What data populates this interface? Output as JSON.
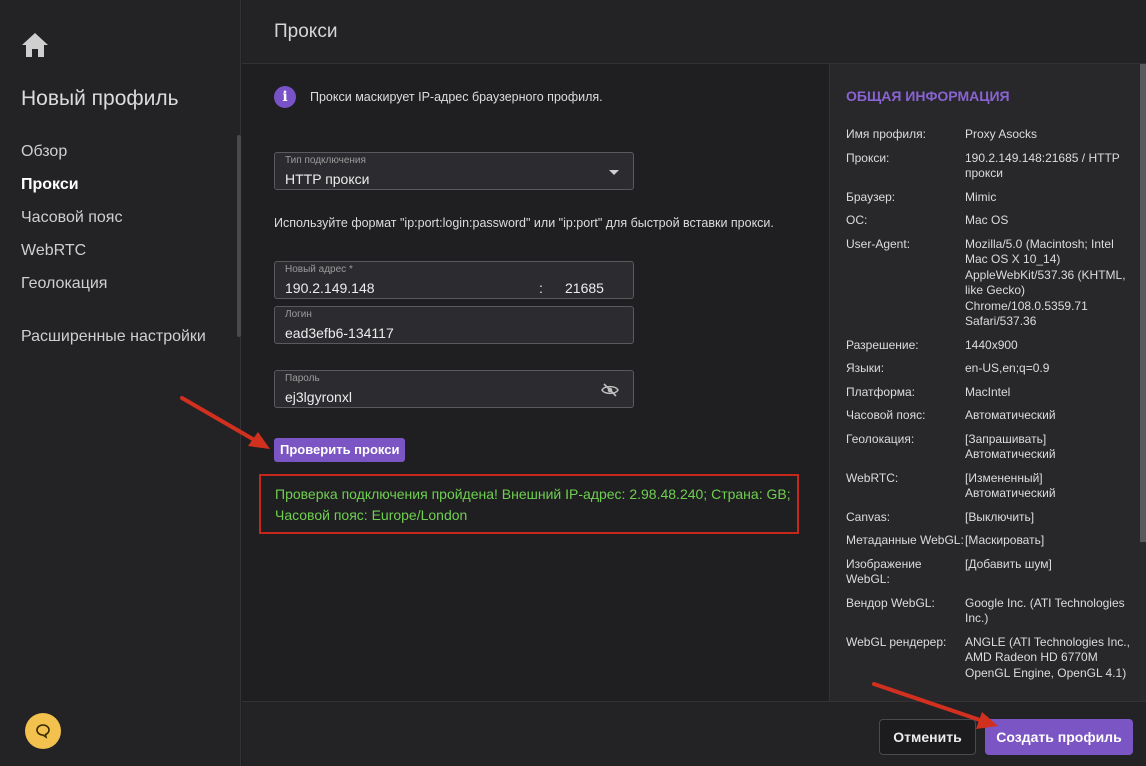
{
  "sidebar": {
    "profile_title": "Новый профиль",
    "items": [
      {
        "label": "Обзор"
      },
      {
        "label": "Прокси"
      },
      {
        "label": "Часовой пояс"
      },
      {
        "label": "WebRTC"
      },
      {
        "label": "Геолокация"
      }
    ],
    "advanced_label": "Расширенные настройки"
  },
  "header": {
    "title": "Прокси"
  },
  "main": {
    "info_text": "Прокси маскирует IP-адрес браузерного профиля.",
    "connection_type": {
      "label": "Тип подключения",
      "value": "HTTP прокси"
    },
    "hint": "Используйте формат \"ip:port:login:password\" или \"ip:port\" для быстрой вставки прокси.",
    "address": {
      "label": "Новый адрес *",
      "value": "190.2.149.148",
      "separator": ":",
      "port": "21685"
    },
    "login": {
      "label": "Логин",
      "value": "ead3efb6-134117"
    },
    "password": {
      "label": "Пароль",
      "value": "ej3lgyronxl"
    },
    "check_button": "Проверить прокси",
    "result": "Проверка подключения пройдена! Внешний IP-адрес: 2.98.48.240; Страна: GB; Часовой пояс: Europe/London"
  },
  "panel": {
    "title": "ОБЩАЯ ИНФОРМАЦИЯ",
    "rows": [
      {
        "key": "Имя профиля:",
        "value": "Proxy Asocks"
      },
      {
        "key": "Прокси:",
        "value": "190.2.149.148:21685 / HTTP прокси"
      },
      {
        "key": "Браузер:",
        "value": "Mimic"
      },
      {
        "key": "ОС:",
        "value": "Mac OS"
      },
      {
        "key": "User-Agent:",
        "value": "Mozilla/5.0 (Macintosh; Intel Mac OS X 10_14) AppleWebKit/537.36 (KHTML, like Gecko) Chrome/108.0.5359.71 Safari/537.36"
      },
      {
        "key": "Разрешение:",
        "value": "1440x900"
      },
      {
        "key": "Языки:",
        "value": "en-US,en;q=0.9"
      },
      {
        "key": "Платформа:",
        "value": "MacIntel"
      },
      {
        "key": "Часовой пояс:",
        "value": "Автоматический"
      },
      {
        "key": "Геолокация:",
        "value": "[Запрашивать] Автоматический"
      },
      {
        "key": "WebRTC:",
        "value": "[Измененный] Автоматический"
      },
      {
        "key": "Canvas:",
        "value": "[Выключить]"
      },
      {
        "key": "Метаданные WebGL:",
        "value": "[Маскировать]"
      },
      {
        "key": "Изображение WebGL:",
        "value": "[Добавить шум]"
      },
      {
        "key": "Вендор WebGL:",
        "value": "Google Inc. (ATI Technologies Inc.)"
      },
      {
        "key": "WebGL рендерер:",
        "value": "ANGLE (ATI Technologies Inc., AMD Radeon HD 6770M OpenGL Engine, OpenGL 4.1)"
      }
    ]
  },
  "footer": {
    "cancel_label": "Отменить",
    "create_label": "Создать профиль"
  },
  "colors": {
    "accent": "#7b55c4",
    "success": "#6fcf4f",
    "annotation": "#c4281c",
    "help": "#f2c14e"
  }
}
